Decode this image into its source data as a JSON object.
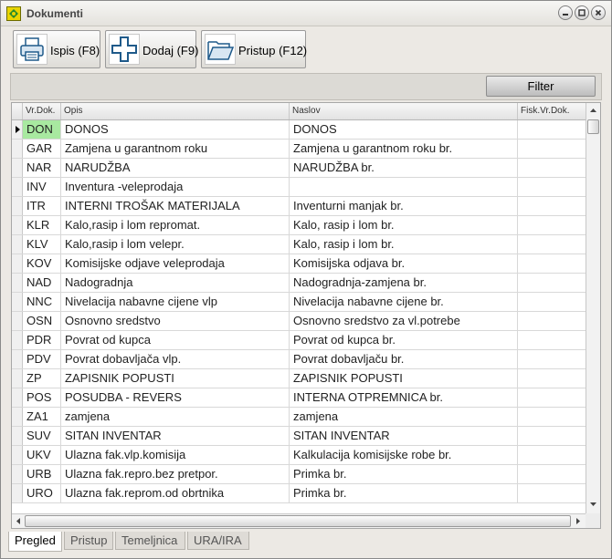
{
  "window": {
    "title": "Dokumenti"
  },
  "toolbar": {
    "buttons": [
      {
        "label": "Ispis (F8)",
        "icon": "printer-icon"
      },
      {
        "label": "Dodaj (F9)",
        "icon": "plus-icon"
      },
      {
        "label": "Pristup (F12)",
        "icon": "folder-open-icon"
      }
    ]
  },
  "filter": {
    "label": "Filter"
  },
  "grid": {
    "columns": [
      "Vr.Dok.",
      "Opis",
      "Naslov",
      "Fisk.Vr.Dok."
    ],
    "rows": [
      {
        "vr": "DON",
        "opis": "DONOS",
        "naslov": "DONOS",
        "fisk": ""
      },
      {
        "vr": "GAR",
        "opis": "Zamjena u garantnom roku",
        "naslov": "Zamjena u garantnom roku br.",
        "fisk": ""
      },
      {
        "vr": "NAR",
        "opis": "NARUDŽBA",
        "naslov": "NARUDŽBA br.",
        "fisk": ""
      },
      {
        "vr": "INV",
        "opis": "Inventura -veleprodaja",
        "naslov": "",
        "fisk": ""
      },
      {
        "vr": "ITR",
        "opis": "INTERNI TROŠAK MATERIJALA",
        "naslov": "Inventurni manjak br.",
        "fisk": ""
      },
      {
        "vr": "KLR",
        "opis": "Kalo,rasip i lom repromat.",
        "naslov": "Kalo, rasip i lom br.",
        "fisk": ""
      },
      {
        "vr": "KLV",
        "opis": "Kalo,rasip i lom velepr.",
        "naslov": "Kalo, rasip i lom br.",
        "fisk": ""
      },
      {
        "vr": "KOV",
        "opis": "Komisijske odjave veleprodaja",
        "naslov": "Komisijska odjava br.",
        "fisk": ""
      },
      {
        "vr": "NAD",
        "opis": "Nadogradnja",
        "naslov": "Nadogradnja-zamjena br.",
        "fisk": ""
      },
      {
        "vr": "NNC",
        "opis": "Nivelacija nabavne cijene vlp",
        "naslov": "Nivelacija nabavne cijene br.",
        "fisk": ""
      },
      {
        "vr": "OSN",
        "opis": "Osnovno sredstvo",
        "naslov": "Osnovno sredstvo za vl.potrebe",
        "fisk": ""
      },
      {
        "vr": "PDR",
        "opis": "Povrat od kupca",
        "naslov": "Povrat od kupca br.",
        "fisk": ""
      },
      {
        "vr": "PDV",
        "opis": "Povrat dobavljača vlp.",
        "naslov": "Povrat dobavljaču br.",
        "fisk": ""
      },
      {
        "vr": "ZP",
        "opis": "ZAPISNIK POPUSTI",
        "naslov": "ZAPISNIK POPUSTI",
        "fisk": ""
      },
      {
        "vr": "POS",
        "opis": "POSUDBA - REVERS",
        "naslov": "INTERNA OTPREMNICA br.",
        "fisk": ""
      },
      {
        "vr": "ZA1",
        "opis": "zamjena",
        "naslov": "zamjena",
        "fisk": ""
      },
      {
        "vr": "SUV",
        "opis": "SITAN INVENTAR",
        "naslov": "SITAN INVENTAR",
        "fisk": ""
      },
      {
        "vr": "UKV",
        "opis": "Ulazna fak.vlp.komisija",
        "naslov": "Kalkulacija komisijske robe br.",
        "fisk": ""
      },
      {
        "vr": "URB",
        "opis": "Ulazna fak.repro.bez pretpor.",
        "naslov": "Primka br.",
        "fisk": ""
      },
      {
        "vr": "URO",
        "opis": "Ulazna fak.reprom.od obrtnika",
        "naslov": "Primka br.",
        "fisk": ""
      }
    ],
    "selected_row": 0,
    "selected_color": "#a8e9a0"
  },
  "tabs": [
    "Pregled",
    "Pristup",
    "Temeljnica",
    "URA/IRA"
  ],
  "active_tab": 0
}
